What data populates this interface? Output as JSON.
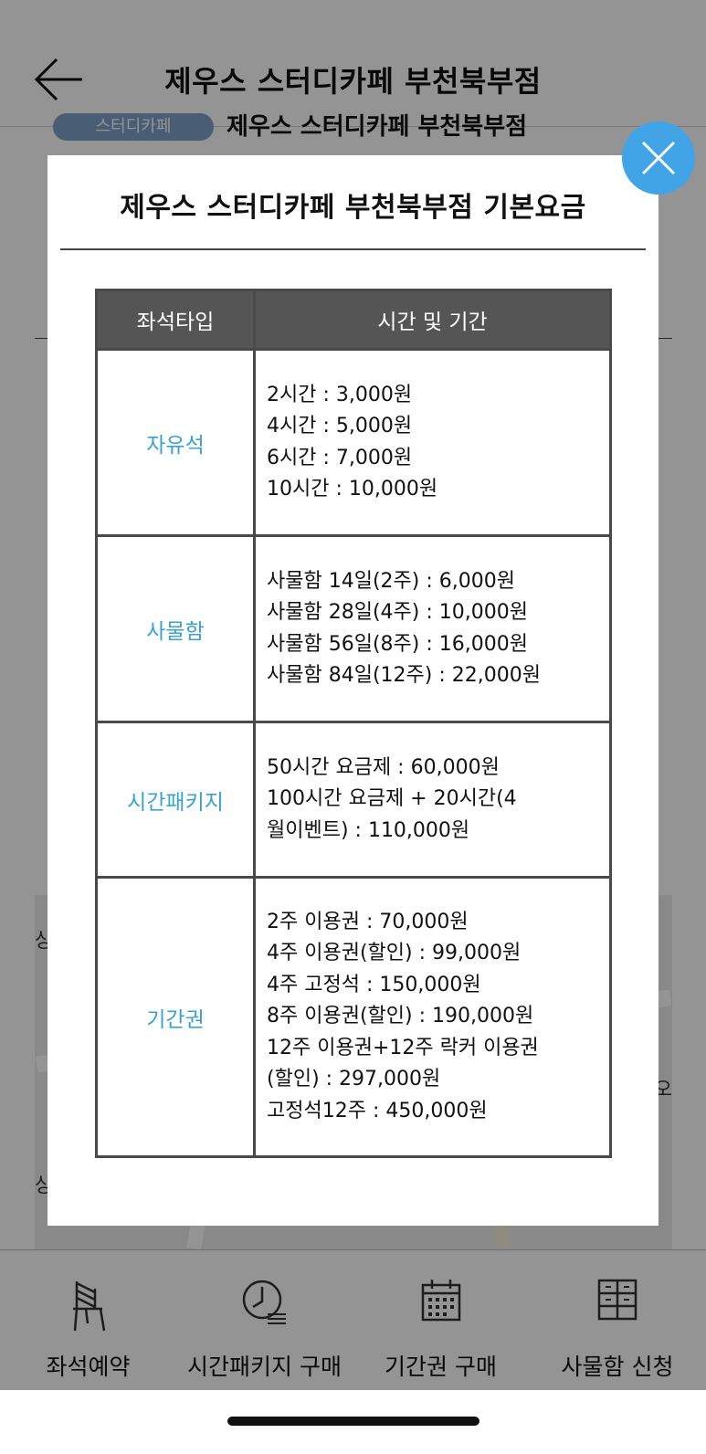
{
  "header": {
    "title": "제우스 스터디카페 부천북부점"
  },
  "subheader": {
    "badge": "스터디카페",
    "name": "제우스 스터디카페 부천북부점"
  },
  "map": {
    "label_left_1": "상",
    "label_left_2": "상",
    "label_right": "오"
  },
  "modal": {
    "title": "제우스 스터디카페 부천북부점 기본요금",
    "columns": [
      "좌석타입",
      "시간 및 기간"
    ],
    "rows": [
      {
        "type": "자유석",
        "lines": [
          "2시간 : 3,000원",
          "4시간 : 5,000원",
          "6시간 : 7,000원",
          "10시간 : 10,000원"
        ]
      },
      {
        "type": "사물함",
        "lines": [
          "사물함 14일(2주) : 6,000원",
          "사물함 28일(4주) : 10,000원",
          "사물함 56일(8주) : 16,000원",
          "사물함 84일(12주) : 22,000원"
        ]
      },
      {
        "type": "시간패키지",
        "lines": [
          "50시간 요금제 : 60,000원",
          "100시간 요금제 + 20시간(4",
          "월이벤트) : 110,000원"
        ]
      },
      {
        "type": "기간권",
        "lines": [
          "2주 이용권 : 70,000원",
          "4주 이용권(할인) : 99,000원",
          "4주 고정석 : 150,000원",
          "8주 이용권(할인) : 190,000원",
          "12주 이용권+12주 락커 이용권",
          "(할인) : 297,000원",
          "고정석12주 : 450,000원"
        ]
      }
    ]
  },
  "bottom_nav": {
    "items": [
      {
        "label": "좌석예약",
        "icon": "chair-icon"
      },
      {
        "label": "시간패키지 구매",
        "icon": "clock-icon"
      },
      {
        "label": "기간권 구매",
        "icon": "calendar-icon"
      },
      {
        "label": "사물함 신청",
        "icon": "locker-icon"
      }
    ]
  },
  "colors": {
    "accent": "#41a4e6",
    "type_text": "#3aa2d3",
    "table_header": "#555555"
  }
}
